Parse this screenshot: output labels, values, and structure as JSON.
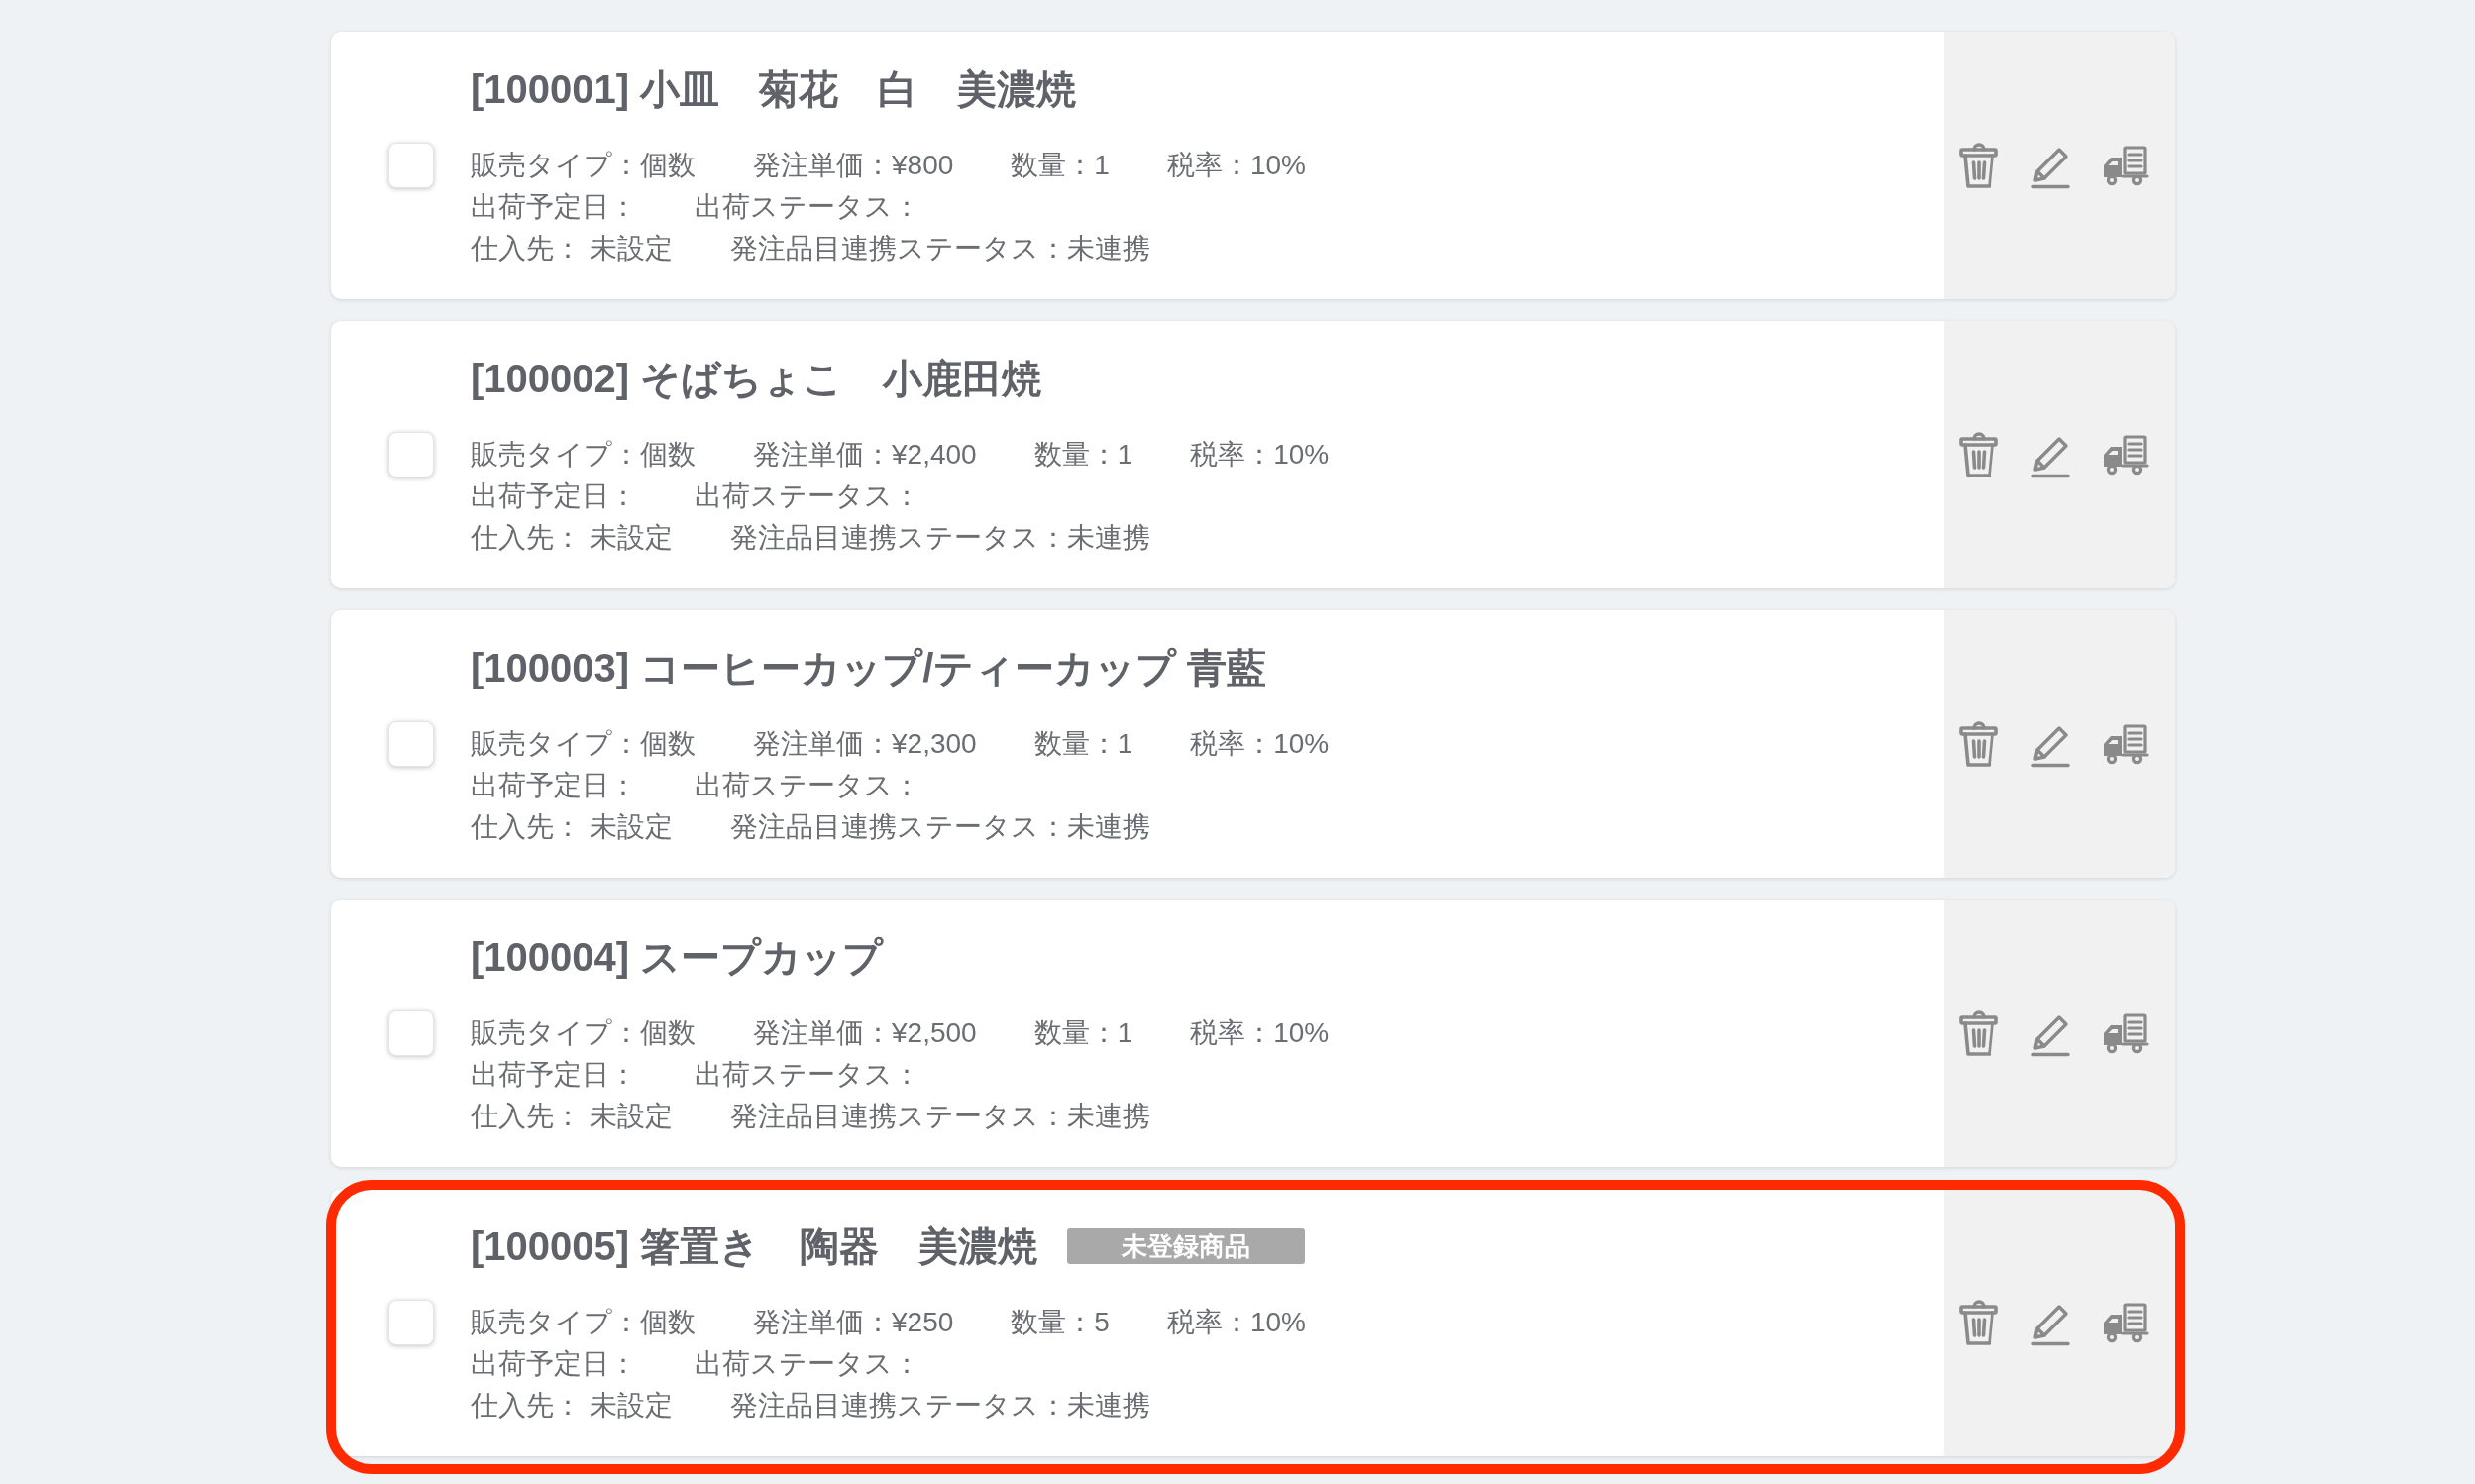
{
  "items": [
    {
      "title": "[100001] 小皿　菊花　白　美濃焼",
      "checked": false,
      "highlighted": false,
      "details": [
        [
          "販売タイプ：個数",
          "発注単価：¥800",
          "数量：1",
          "税率：10%"
        ],
        [
          "出荷予定日：",
          "出荷ステータス："
        ],
        [
          "仕入先： 未設定",
          "発注品目連携ステータス：未連携"
        ]
      ]
    },
    {
      "title": "[100002] そばちょこ　小鹿田焼",
      "checked": false,
      "highlighted": false,
      "details": [
        [
          "販売タイプ：個数",
          "発注単価：¥2,400",
          "数量：1",
          "税率：10%"
        ],
        [
          "出荷予定日：",
          "出荷ステータス："
        ],
        [
          "仕入先： 未設定",
          "発注品目連携ステータス：未連携"
        ]
      ]
    },
    {
      "title": "[100003] コーヒーカップ/ティーカップ 青藍",
      "checked": false,
      "highlighted": false,
      "details": [
        [
          "販売タイプ：個数",
          "発注単価：¥2,300",
          "数量：1",
          "税率：10%"
        ],
        [
          "出荷予定日：",
          "出荷ステータス："
        ],
        [
          "仕入先： 未設定",
          "発注品目連携ステータス：未連携"
        ]
      ]
    },
    {
      "title": "[100004] スープカップ",
      "checked": false,
      "highlighted": false,
      "details": [
        [
          "販売タイプ：個数",
          "発注単価：¥2,500",
          "数量：1",
          "税率：10%"
        ],
        [
          "出荷予定日：",
          "出荷ステータス："
        ],
        [
          "仕入先： 未設定",
          "発注品目連携ステータス：未連携"
        ]
      ]
    },
    {
      "title": "[100005] 箸置き　陶器　美濃焼",
      "badge": "未登録商品",
      "checked": false,
      "highlighted": true,
      "details": [
        [
          "販売タイプ：個数",
          "発注単価：¥250",
          "数量：5",
          "税率：10%"
        ],
        [
          "出荷予定日：",
          "出荷ステータス："
        ],
        [
          "仕入先： 未設定",
          "発注品目連携ステータス：未連携"
        ]
      ]
    }
  ]
}
